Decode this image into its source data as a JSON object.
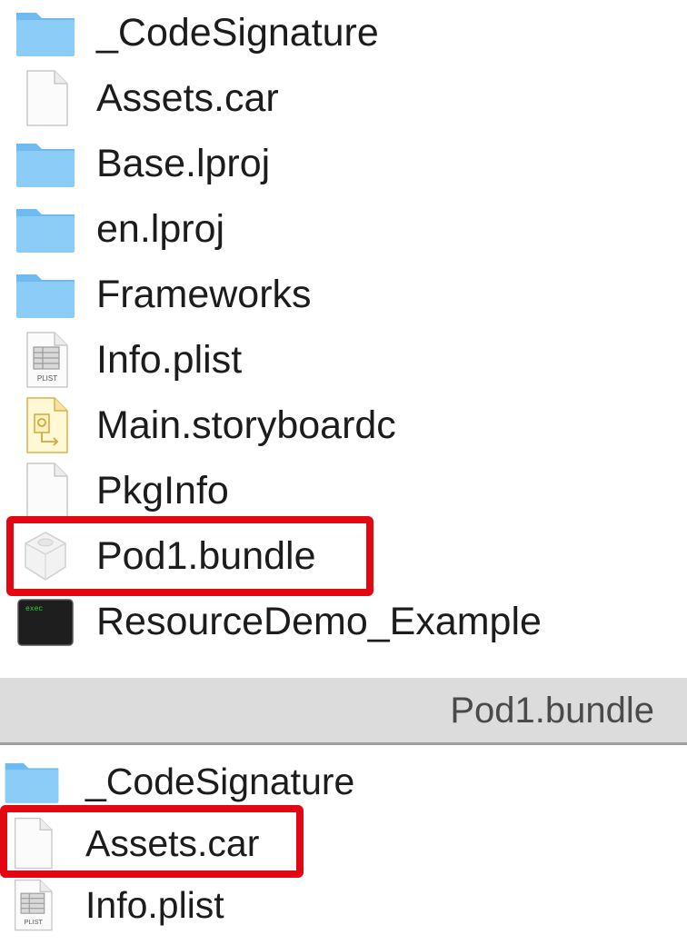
{
  "top_list": {
    "items": [
      {
        "label": "_CodeSignature",
        "icon": "folder-icon"
      },
      {
        "label": "Assets.car",
        "icon": "document-icon"
      },
      {
        "label": "Base.lproj",
        "icon": "folder-icon"
      },
      {
        "label": "en.lproj",
        "icon": "folder-icon"
      },
      {
        "label": "Frameworks",
        "icon": "folder-icon"
      },
      {
        "label": "Info.plist",
        "icon": "plist-icon",
        "badge": "PLIST"
      },
      {
        "label": "Main.storyboardc",
        "icon": "storyboard-icon"
      },
      {
        "label": "PkgInfo",
        "icon": "document-icon"
      },
      {
        "label": "Pod1.bundle",
        "icon": "bundle-icon",
        "highlighted": true
      },
      {
        "label": "ResourceDemo_Example",
        "icon": "terminal-icon",
        "terminal_text": "exec"
      }
    ]
  },
  "bottom_pane": {
    "title": "Pod1.bundle",
    "items": [
      {
        "label": "_CodeSignature",
        "icon": "folder-icon"
      },
      {
        "label": "Assets.car",
        "icon": "document-icon",
        "highlighted": true
      },
      {
        "label": "Info.plist",
        "icon": "plist-icon",
        "badge": "PLIST"
      }
    ]
  },
  "colors": {
    "highlight": "#e30613",
    "folder": "#8ccdf7",
    "folder_tab": "#6fbbef",
    "pane_header": "#dcdcdc"
  }
}
